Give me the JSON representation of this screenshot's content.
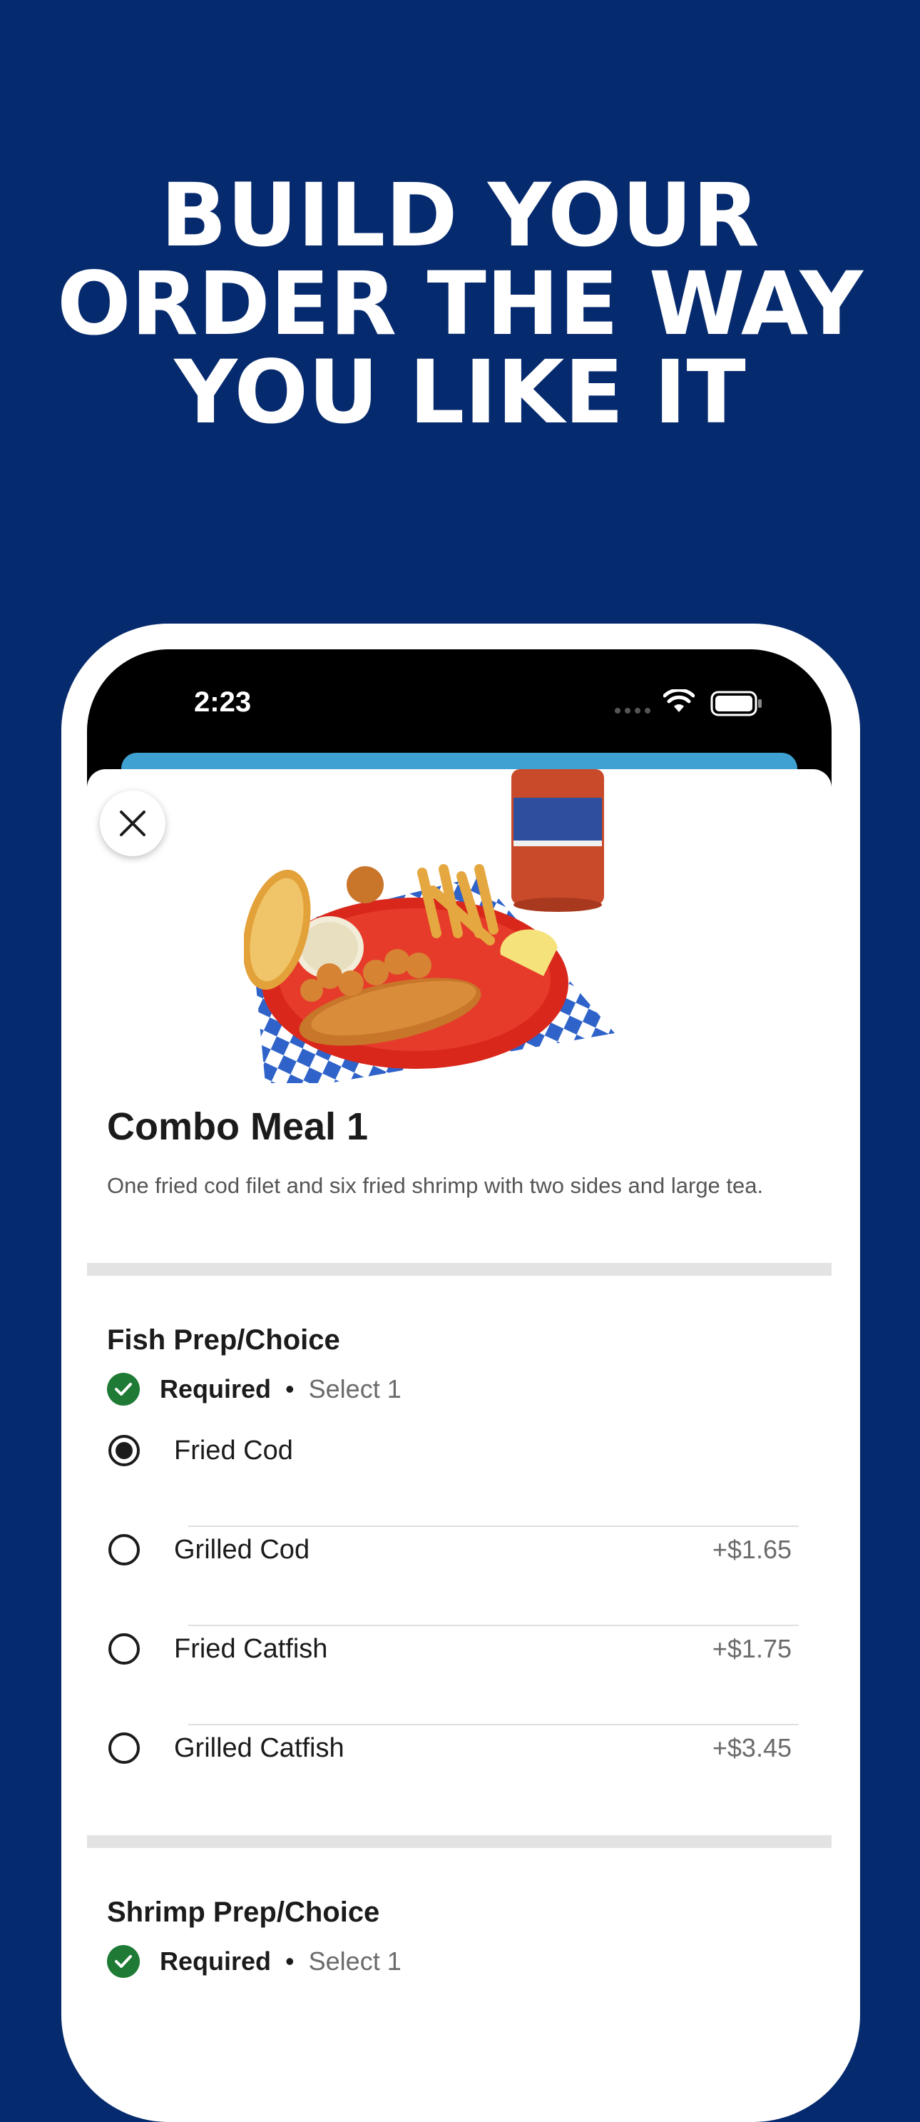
{
  "headline": [
    "BUILD YOUR",
    "ORDER THE WAY",
    "YOU LIKE IT"
  ],
  "status_bar": {
    "time": "2:23",
    "icons": [
      "signal-icon",
      "wifi-icon",
      "battery-icon"
    ]
  },
  "item": {
    "title": "Combo Meal 1",
    "description": "One fried cod filet and six fried shrimp with two sides and large tea."
  },
  "sections": [
    {
      "title": "Fish Prep/Choice",
      "required_label": "Required",
      "separator": "•",
      "select_label": "Select 1",
      "options": [
        {
          "label": "Fried Cod",
          "price": "",
          "selected": true
        },
        {
          "label": "Grilled Cod",
          "price": "+$1.65",
          "selected": false
        },
        {
          "label": "Fried Catfish",
          "price": "+$1.75",
          "selected": false
        },
        {
          "label": "Grilled Catfish",
          "price": "+$3.45",
          "selected": false
        }
      ]
    },
    {
      "title": "Shrimp Prep/Choice",
      "required_label": "Required",
      "separator": "•",
      "select_label": "Select 1",
      "options": []
    }
  ],
  "colors": {
    "background": "#062a6e",
    "accent_blue": "#3ea1d1",
    "required_green": "#1e7a35"
  }
}
